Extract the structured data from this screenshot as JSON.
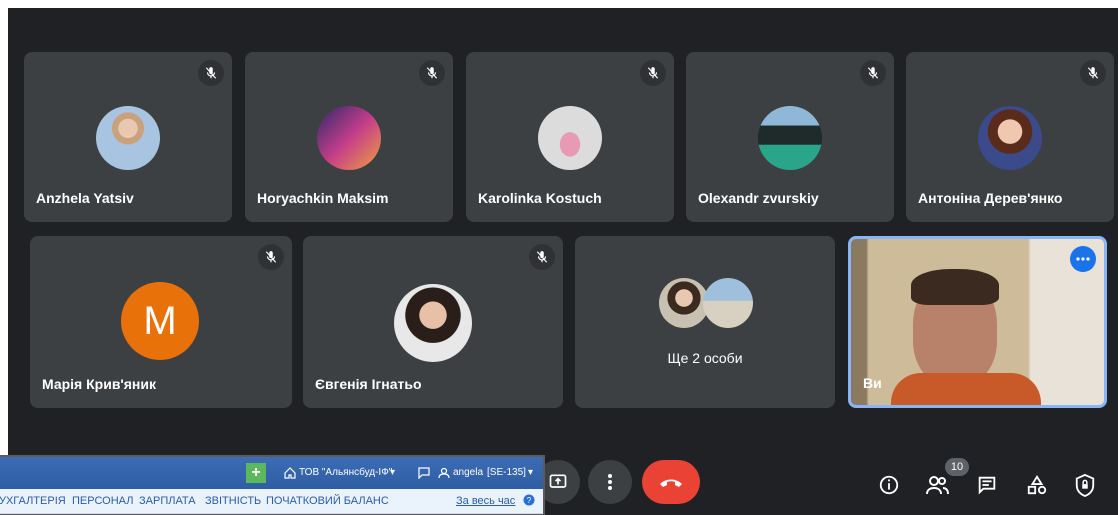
{
  "participants": [
    {
      "name": "Anzhela Yatsiv",
      "muted": true
    },
    {
      "name": "Horyachkin Maksim",
      "muted": true
    },
    {
      "name": "Karolinka Kostuch",
      "muted": true
    },
    {
      "name": "Olexandr zvurskiy",
      "muted": true
    },
    {
      "name": "Антоніна Дерев'янко",
      "muted": true
    },
    {
      "name": "Марія Крив'яник",
      "muted": true,
      "initial": "M"
    },
    {
      "name": "Євгенія Ігнатьо",
      "muted": true
    },
    {
      "name": "Ще 2 особи"
    },
    {
      "name": "Ви"
    }
  ],
  "controls": {
    "participants_count": "10"
  },
  "overlay_app": {
    "company": "ТОВ \"Альянсбуд-ІФ\"",
    "user": "angela",
    "user_code": "[SE-135]",
    "menu": [
      "БУХГАЛТЕРІЯ",
      "ПЕРСОНАЛ",
      "ЗАРПЛАТА",
      "ЗВІТНІСТЬ",
      "ПОЧАТКОВИЙ БАЛАНС"
    ],
    "period": "За весь час"
  },
  "colors": {
    "background": "#202124",
    "tile": "#3c4043",
    "end_call": "#ea4335",
    "self_border": "#8ab4f8",
    "avatar_m": "#e8710a"
  }
}
